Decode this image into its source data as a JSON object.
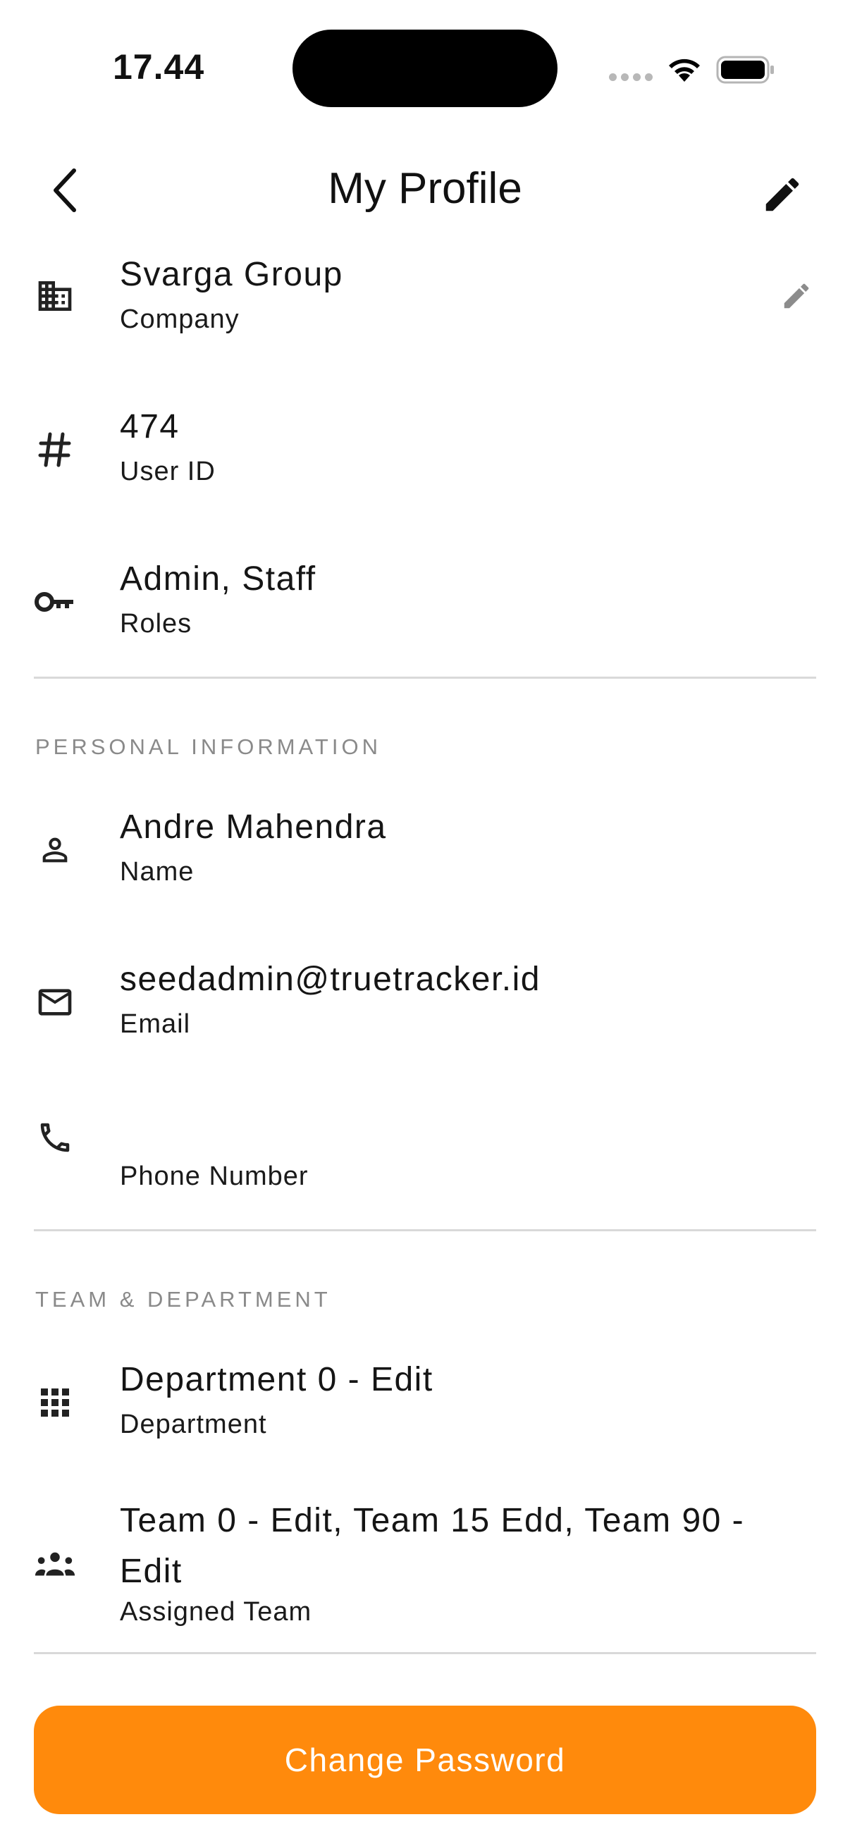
{
  "status_bar": {
    "time": "17.44"
  },
  "header": {
    "title": "My Profile"
  },
  "account": [
    {
      "value": "Svarga Group",
      "label": "Company",
      "icon": "building-icon"
    },
    {
      "value": "474",
      "label": "User ID",
      "icon": "hash-icon"
    },
    {
      "value": "Admin, Staff",
      "label": "Roles",
      "icon": "key-icon"
    }
  ],
  "personal": {
    "heading": "PERSONAL INFORMATION",
    "name": {
      "value": "Andre Mahendra",
      "label": "Name"
    },
    "email": {
      "value": "seedadmin@truetracker.id",
      "label": "Email"
    },
    "phone": {
      "value": "",
      "label": "Phone Number"
    }
  },
  "team": {
    "heading": "TEAM & DEPARTMENT",
    "department": {
      "value": "Department 0 - Edit",
      "label": "Department"
    },
    "assigned": {
      "value": "Team 0 - Edit, Team 15 Edd, Team 90 - Edit",
      "label": "Assigned Team"
    }
  },
  "actions": {
    "change_password": "Change Password"
  },
  "colors": {
    "accent": "#ff8a0c",
    "divider": "#d9d9d9",
    "section_text": "#8a8a8a"
  }
}
